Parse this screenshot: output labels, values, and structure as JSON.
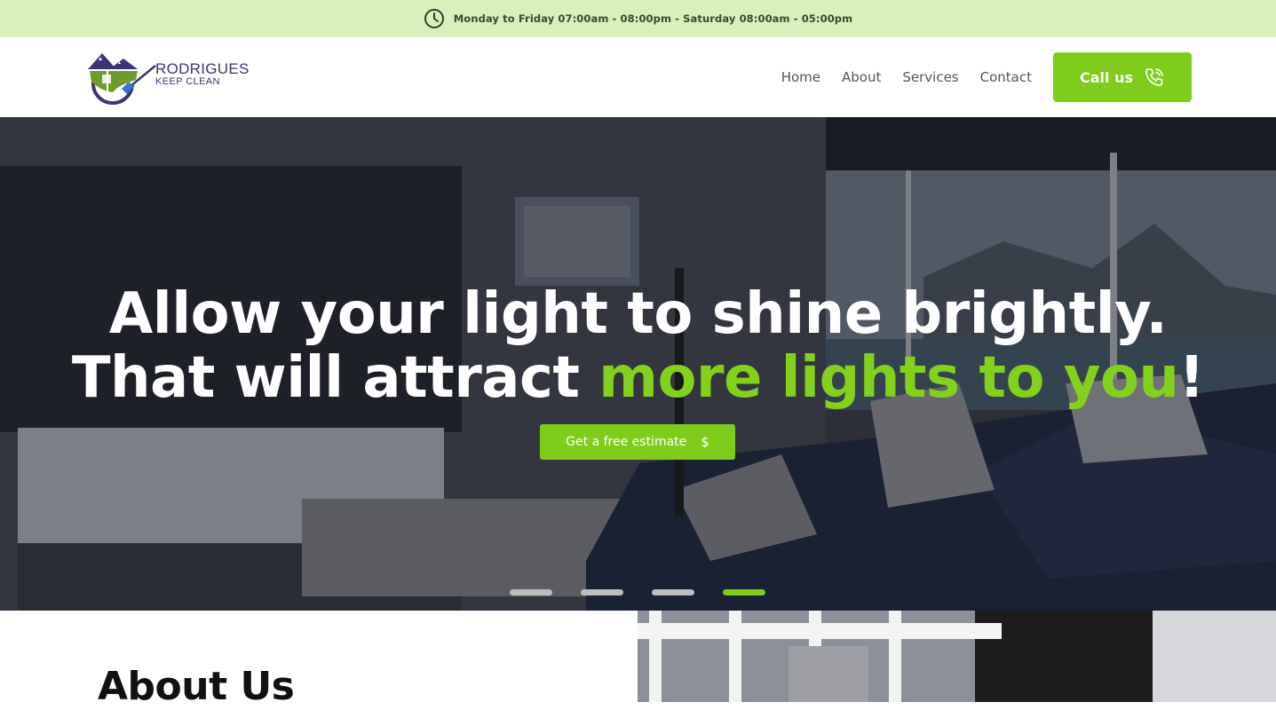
{
  "topbar": {
    "hours": "Monday to Friday 07:00am - 08:00pm - Saturday 08:00am - 05:00pm",
    "icon": "clock-icon"
  },
  "brand": {
    "name": "RODRIGUES",
    "tagline": "KEEP CLEAN"
  },
  "nav": {
    "items": [
      "Home",
      "About",
      "Services",
      "Contact"
    ]
  },
  "cta": {
    "call_label": "Call us",
    "call_icon": "phone-icon"
  },
  "hero": {
    "line1": "Allow your light to shine brightly.",
    "line2_prefix": "That will attract ",
    "line2_accent": "more lights to you",
    "line2_suffix": "!",
    "button_label": "Get a free estimate",
    "button_icon": "$",
    "slides": 4,
    "active_slide": 4
  },
  "about": {
    "title": "About Us"
  },
  "colors": {
    "accent": "#7fcc1d",
    "topbar_bg": "#d9f0bd",
    "brand": "#3b3470"
  }
}
